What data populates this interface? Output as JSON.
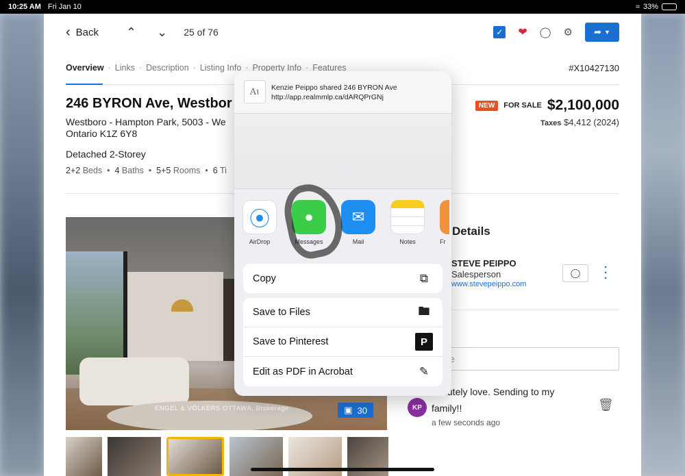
{
  "status": {
    "time": "10:25 AM",
    "date": "Fri Jan 10",
    "battery": "33%",
    "battery_level": 0.33
  },
  "nav": {
    "back_label": "Back",
    "counter": "25 of 76"
  },
  "tabs": [
    "Overview",
    "Links",
    "Description",
    "Listing Info",
    "Property Info",
    "Features"
  ],
  "listing": {
    "mls": "#X10427130",
    "address": "246 BYRON Ave, Westbor",
    "sub1": "Westboro - Hampton Park, 5003 - We",
    "sub2": "Ontario K1Z 6Y8",
    "type": "Detached 2-Storey",
    "beds_num": "2+2",
    "beds_lbl": "Beds",
    "baths_num": "4",
    "baths_lbl": "Baths",
    "rooms_num": "5+5",
    "rooms_lbl": "Rooms",
    "extra_num": "6",
    "extra_lbl": "Ti",
    "badge": "NEW",
    "status": "FOR SALE",
    "price": "$2,100,000",
    "taxes_label": "Taxes",
    "taxes_value": "$4,412 (2024)"
  },
  "photo": {
    "credit": "ENGEL & VÖLKERS OTTAWA, Brokerage",
    "count": "30"
  },
  "details": {
    "title": "Details",
    "agent_name": "STEVE PEIPPO",
    "agent_role": "Salesperson",
    "agent_web": "www.stevepeippo.com",
    "note_placeholder": "e"
  },
  "comment": {
    "initials": "KP",
    "line1": "olutely love. Sending to my",
    "line2": "family!!",
    "time": "a few seconds ago"
  },
  "share_sheet": {
    "message": "Kenzie Peippo shared 246 BYRON Ave  http://app.realmmlp.ca/dARQPrGNj",
    "apps": [
      {
        "label": "AirDrop",
        "icon": "airdrop-icon"
      },
      {
        "label": "Messages",
        "icon": "messages-icon"
      },
      {
        "label": "Mail",
        "icon": "mail-icon"
      },
      {
        "label": "Notes",
        "icon": "notes-icon"
      },
      {
        "label": "Fr",
        "icon": "app-icon"
      }
    ],
    "copy": "Copy",
    "actions": [
      "Save to Files",
      "Save to Pinterest",
      "Edit as PDF in Acrobat"
    ]
  }
}
